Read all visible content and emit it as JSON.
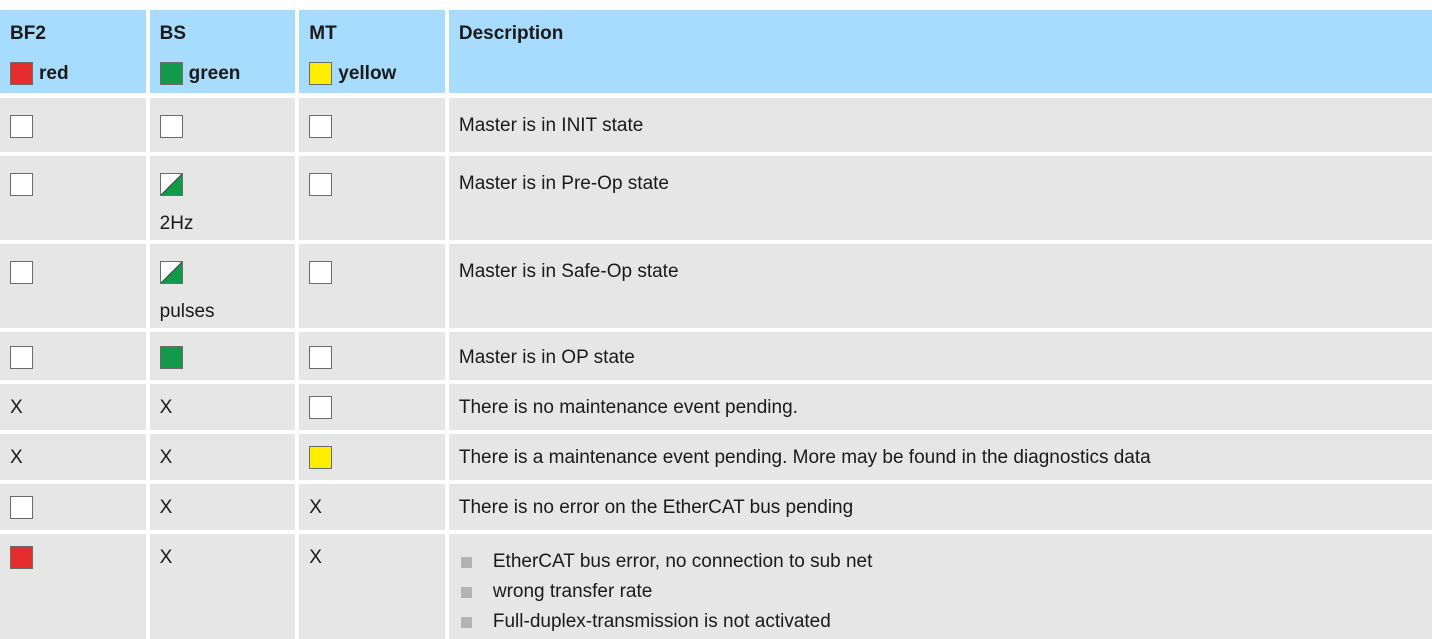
{
  "header": {
    "columns": [
      {
        "title": "BF2",
        "led_label": "red",
        "led_color": "red"
      },
      {
        "title": "BS",
        "led_label": "green",
        "led_color": "green"
      },
      {
        "title": "MT",
        "led_label": "yellow",
        "led_color": "yellow"
      },
      {
        "title": "Description"
      }
    ]
  },
  "colors": {
    "header_bg": "#a8dcff",
    "row_bg": "#e6e6e6",
    "red": "#e52d2d",
    "green": "#129a4a",
    "yellow": "#ffee00"
  },
  "rows": [
    {
      "bf2": "off",
      "bs": "off",
      "bs_note": "",
      "mt": "off",
      "description": "Master is in INIT state"
    },
    {
      "bf2": "off",
      "bs": "blinking",
      "bs_note": "2Hz",
      "mt": "off",
      "description": "Master is in Pre-Op state"
    },
    {
      "bf2": "off",
      "bs": "blinking",
      "bs_note": "pulses",
      "mt": "off",
      "description": "Master is in Safe-Op state"
    },
    {
      "bf2": "off",
      "bs": "on",
      "bs_note": "",
      "mt": "off",
      "description": "Master is in OP state"
    },
    {
      "bf2": "X",
      "bs": "X",
      "bs_note": "",
      "mt": "off",
      "description": "There is no maintenance event pending."
    },
    {
      "bf2": "X",
      "bs": "X",
      "bs_note": "",
      "mt": "on",
      "description": "There is a maintenance event pending. More may be found in the diagnostics data"
    },
    {
      "bf2": "off",
      "bs": "X",
      "bs_note": "",
      "mt": "X",
      "description": "There is no error on the EtherCAT bus pending"
    },
    {
      "bf2": "on",
      "bs": "X",
      "bs_note": "",
      "mt": "X",
      "bullets": [
        "EtherCAT bus error, no connection to sub net",
        "wrong transfer rate",
        "Full-duplex-transmission is not activated"
      ]
    }
  ]
}
